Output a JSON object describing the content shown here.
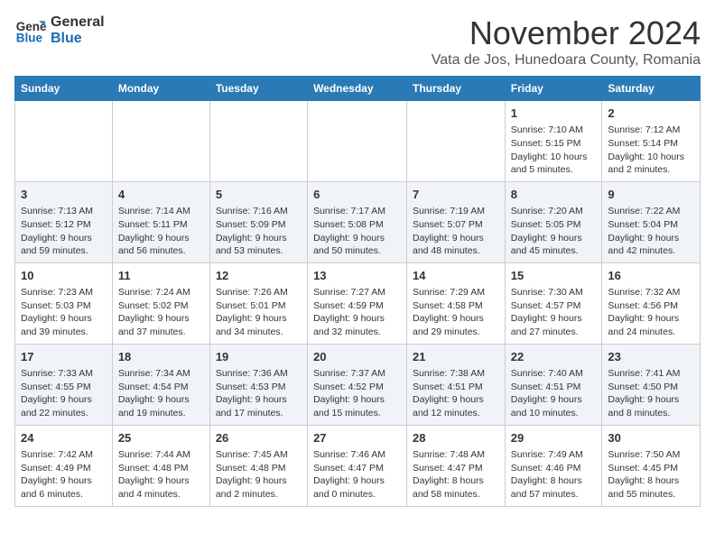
{
  "header": {
    "logo_line1": "General",
    "logo_line2": "Blue",
    "month": "November 2024",
    "location": "Vata de Jos, Hunedoara County, Romania"
  },
  "weekdays": [
    "Sunday",
    "Monday",
    "Tuesday",
    "Wednesday",
    "Thursday",
    "Friday",
    "Saturday"
  ],
  "weeks": [
    [
      {
        "day": "",
        "info": ""
      },
      {
        "day": "",
        "info": ""
      },
      {
        "day": "",
        "info": ""
      },
      {
        "day": "",
        "info": ""
      },
      {
        "day": "",
        "info": ""
      },
      {
        "day": "1",
        "info": "Sunrise: 7:10 AM\nSunset: 5:15 PM\nDaylight: 10 hours and 5 minutes."
      },
      {
        "day": "2",
        "info": "Sunrise: 7:12 AM\nSunset: 5:14 PM\nDaylight: 10 hours and 2 minutes."
      }
    ],
    [
      {
        "day": "3",
        "info": "Sunrise: 7:13 AM\nSunset: 5:12 PM\nDaylight: 9 hours and 59 minutes."
      },
      {
        "day": "4",
        "info": "Sunrise: 7:14 AM\nSunset: 5:11 PM\nDaylight: 9 hours and 56 minutes."
      },
      {
        "day": "5",
        "info": "Sunrise: 7:16 AM\nSunset: 5:09 PM\nDaylight: 9 hours and 53 minutes."
      },
      {
        "day": "6",
        "info": "Sunrise: 7:17 AM\nSunset: 5:08 PM\nDaylight: 9 hours and 50 minutes."
      },
      {
        "day": "7",
        "info": "Sunrise: 7:19 AM\nSunset: 5:07 PM\nDaylight: 9 hours and 48 minutes."
      },
      {
        "day": "8",
        "info": "Sunrise: 7:20 AM\nSunset: 5:05 PM\nDaylight: 9 hours and 45 minutes."
      },
      {
        "day": "9",
        "info": "Sunrise: 7:22 AM\nSunset: 5:04 PM\nDaylight: 9 hours and 42 minutes."
      }
    ],
    [
      {
        "day": "10",
        "info": "Sunrise: 7:23 AM\nSunset: 5:03 PM\nDaylight: 9 hours and 39 minutes."
      },
      {
        "day": "11",
        "info": "Sunrise: 7:24 AM\nSunset: 5:02 PM\nDaylight: 9 hours and 37 minutes."
      },
      {
        "day": "12",
        "info": "Sunrise: 7:26 AM\nSunset: 5:01 PM\nDaylight: 9 hours and 34 minutes."
      },
      {
        "day": "13",
        "info": "Sunrise: 7:27 AM\nSunset: 4:59 PM\nDaylight: 9 hours and 32 minutes."
      },
      {
        "day": "14",
        "info": "Sunrise: 7:29 AM\nSunset: 4:58 PM\nDaylight: 9 hours and 29 minutes."
      },
      {
        "day": "15",
        "info": "Sunrise: 7:30 AM\nSunset: 4:57 PM\nDaylight: 9 hours and 27 minutes."
      },
      {
        "day": "16",
        "info": "Sunrise: 7:32 AM\nSunset: 4:56 PM\nDaylight: 9 hours and 24 minutes."
      }
    ],
    [
      {
        "day": "17",
        "info": "Sunrise: 7:33 AM\nSunset: 4:55 PM\nDaylight: 9 hours and 22 minutes."
      },
      {
        "day": "18",
        "info": "Sunrise: 7:34 AM\nSunset: 4:54 PM\nDaylight: 9 hours and 19 minutes."
      },
      {
        "day": "19",
        "info": "Sunrise: 7:36 AM\nSunset: 4:53 PM\nDaylight: 9 hours and 17 minutes."
      },
      {
        "day": "20",
        "info": "Sunrise: 7:37 AM\nSunset: 4:52 PM\nDaylight: 9 hours and 15 minutes."
      },
      {
        "day": "21",
        "info": "Sunrise: 7:38 AM\nSunset: 4:51 PM\nDaylight: 9 hours and 12 minutes."
      },
      {
        "day": "22",
        "info": "Sunrise: 7:40 AM\nSunset: 4:51 PM\nDaylight: 9 hours and 10 minutes."
      },
      {
        "day": "23",
        "info": "Sunrise: 7:41 AM\nSunset: 4:50 PM\nDaylight: 9 hours and 8 minutes."
      }
    ],
    [
      {
        "day": "24",
        "info": "Sunrise: 7:42 AM\nSunset: 4:49 PM\nDaylight: 9 hours and 6 minutes."
      },
      {
        "day": "25",
        "info": "Sunrise: 7:44 AM\nSunset: 4:48 PM\nDaylight: 9 hours and 4 minutes."
      },
      {
        "day": "26",
        "info": "Sunrise: 7:45 AM\nSunset: 4:48 PM\nDaylight: 9 hours and 2 minutes."
      },
      {
        "day": "27",
        "info": "Sunrise: 7:46 AM\nSunset: 4:47 PM\nDaylight: 9 hours and 0 minutes."
      },
      {
        "day": "28",
        "info": "Sunrise: 7:48 AM\nSunset: 4:47 PM\nDaylight: 8 hours and 58 minutes."
      },
      {
        "day": "29",
        "info": "Sunrise: 7:49 AM\nSunset: 4:46 PM\nDaylight: 8 hours and 57 minutes."
      },
      {
        "day": "30",
        "info": "Sunrise: 7:50 AM\nSunset: 4:45 PM\nDaylight: 8 hours and 55 minutes."
      }
    ]
  ]
}
